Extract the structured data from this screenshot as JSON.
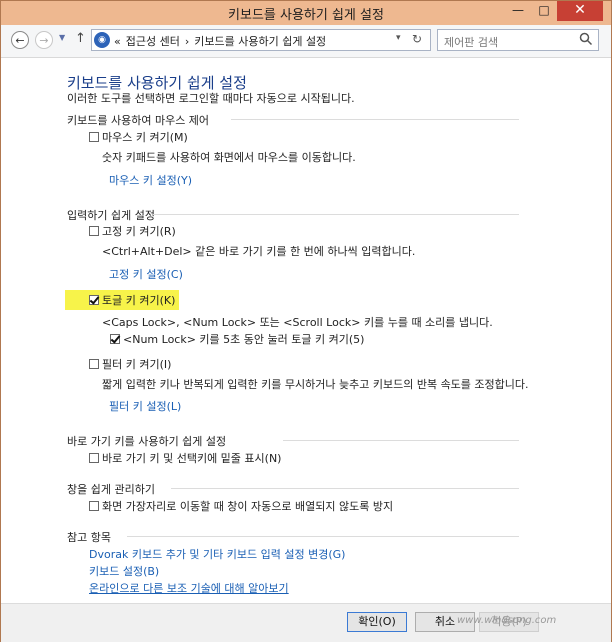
{
  "window": {
    "title": "키보드를 사용하기 쉽게 설정",
    "minimize": "—",
    "maximize": "□",
    "close": "✕"
  },
  "nav": {
    "back": "←",
    "forward": "→",
    "dropdown": "▼",
    "up": "↑",
    "address_prefix": "«",
    "breadcrumbs": [
      "접근성 센터",
      "›",
      "키보드를 사용하기 쉽게 설정"
    ],
    "address_dropdown": "▾",
    "refresh": "↻",
    "search_placeholder": "제어판 검색"
  },
  "page": {
    "title": "키보드를 사용하기 쉽게 설정",
    "description": "이러한 도구를 선택하면 로그인할 때마다 자동으로 시작됩니다."
  },
  "sections": {
    "mouse": {
      "header": "키보드를 사용하여 마우스 제어",
      "mouse_keys": "마우스 키 켜기(M)",
      "mouse_keys_desc": "숫자 키패드를 사용하여 화면에서 마우스를 이동합니다.",
      "mouse_keys_link": "마우스 키 설정(Y)"
    },
    "typing": {
      "header": "입력하기 쉽게 설정",
      "sticky": "고정 키 켜기(R)",
      "sticky_desc": "<Ctrl+Alt+Del> 같은 바로 가기 키를 한 번에 하나씩 입력합니다.",
      "sticky_link": "고정 키 설정(C)",
      "toggle": "토글 키 켜기(K)",
      "toggle_desc": "<Caps Lock>, <Num Lock> 또는 <Scroll Lock> 키를 누를 때 소리를 냅니다.",
      "toggle_sub": "<Num Lock> 키를 5초 동안 눌러 토글 키 켜기(5)",
      "filter": "필터 키 켜기(I)",
      "filter_desc": "짧게 입력한 키나 반복되게 입력한 키를 무시하거나 늦추고 키보드의 반복 속도를 조정합니다.",
      "filter_link": "필터 키 설정(L)"
    },
    "shortcuts": {
      "header": "바로 가기 키를 사용하기 쉽게 설정",
      "underline": "바로 가기 키 및 선택키에 밑줄 표시(N)"
    },
    "windows": {
      "header": "창을 쉽게 관리하기",
      "prevent": "화면 가장자리로 이동할 때 창이 자동으로 배열되지 않도록 방지"
    },
    "related": {
      "header": "참고 항목",
      "dvorak": "Dvorak 키보드 추가 및 기타 키보드 입력 설정 변경(G)",
      "keyboard": "키보드 설정(B)",
      "online": "온라인으로 다른 보조 기술에 대해 알아보기"
    }
  },
  "footer": {
    "ok": "확인(O)",
    "cancel": "취소",
    "apply": "적용(P)"
  },
  "watermark": "www.windsong.com"
}
